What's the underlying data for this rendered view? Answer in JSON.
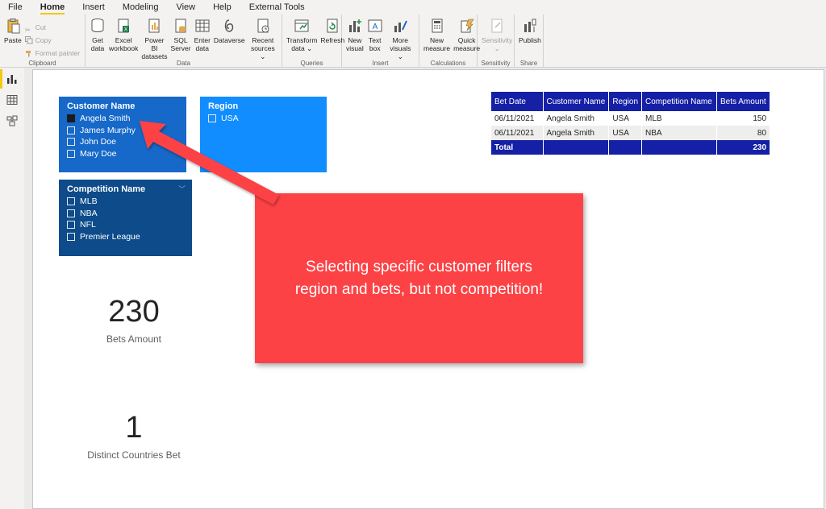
{
  "menu": {
    "items": [
      "File",
      "Home",
      "Insert",
      "Modeling",
      "View",
      "Help",
      "External Tools"
    ]
  },
  "ribbon": {
    "clipboard": {
      "label": "Clipboard",
      "paste": "Paste",
      "cut": "Cut",
      "copy": "Copy",
      "format_painter": "Format painter"
    },
    "data": {
      "label": "Data",
      "get_data_1": "Get",
      "get_data_2": "data",
      "excel_1": "Excel",
      "excel_2": "workbook",
      "powerbi_1": "Power BI",
      "powerbi_2": "datasets",
      "sql_1": "SQL",
      "sql_2": "Server",
      "enter_1": "Enter",
      "enter_2": "data",
      "dataverse": "Dataverse",
      "recent_1": "Recent",
      "recent_2": "sources"
    },
    "queries": {
      "label": "Queries",
      "transform_1": "Transform",
      "transform_2": "data",
      "refresh": "Refresh"
    },
    "insert": {
      "label": "Insert",
      "new_visual_1": "New",
      "new_visual_2": "visual",
      "text_box_1": "Text",
      "text_box_2": "box",
      "more_visuals_1": "More",
      "more_visuals_2": "visuals"
    },
    "calculations": {
      "label": "Calculations",
      "new_measure_1": "New",
      "new_measure_2": "measure",
      "quick_measure_1": "Quick",
      "quick_measure_2": "measure"
    },
    "sensitivity": {
      "label": "Sensitivity",
      "button": "Sensitivity"
    },
    "share": {
      "label": "Share",
      "publish": "Publish"
    }
  },
  "slicers": {
    "customer": {
      "title": "Customer Name",
      "items": [
        "Angela Smith",
        "James Murphy",
        "John Doe",
        "Mary Doe"
      ],
      "checked": [
        true,
        false,
        false,
        false
      ]
    },
    "region": {
      "title": "Region",
      "items": [
        "USA"
      ]
    },
    "competition": {
      "title": "Competition Name",
      "items": [
        "MLB",
        "NBA",
        "NFL",
        "Premier League"
      ]
    }
  },
  "table": {
    "headers": [
      "Bet Date",
      "Customer Name",
      "Region",
      "Competition Name",
      "Bets Amount"
    ],
    "rows": [
      [
        "06/11/2021",
        "Angela Smith",
        "USA",
        "MLB",
        "150"
      ],
      [
        "06/11/2021",
        "Angela Smith",
        "USA",
        "NBA",
        "80"
      ]
    ],
    "total_label": "Total",
    "total_value": "230"
  },
  "cards": {
    "bets": {
      "value": "230",
      "label": "Bets Amount"
    },
    "countries": {
      "value": "1",
      "label": "Distinct Countries Bet"
    }
  },
  "callout": {
    "line1": "Selecting specific customer filters",
    "line2": "region and bets, but not competition!"
  },
  "colors": {
    "customer_slicer": "#1668c9",
    "region_slicer": "#118dff",
    "competition_slicer": "#0d4b8a",
    "table_header": "#1520a6",
    "callout": "#fc4245",
    "accent": "#f2c811"
  }
}
